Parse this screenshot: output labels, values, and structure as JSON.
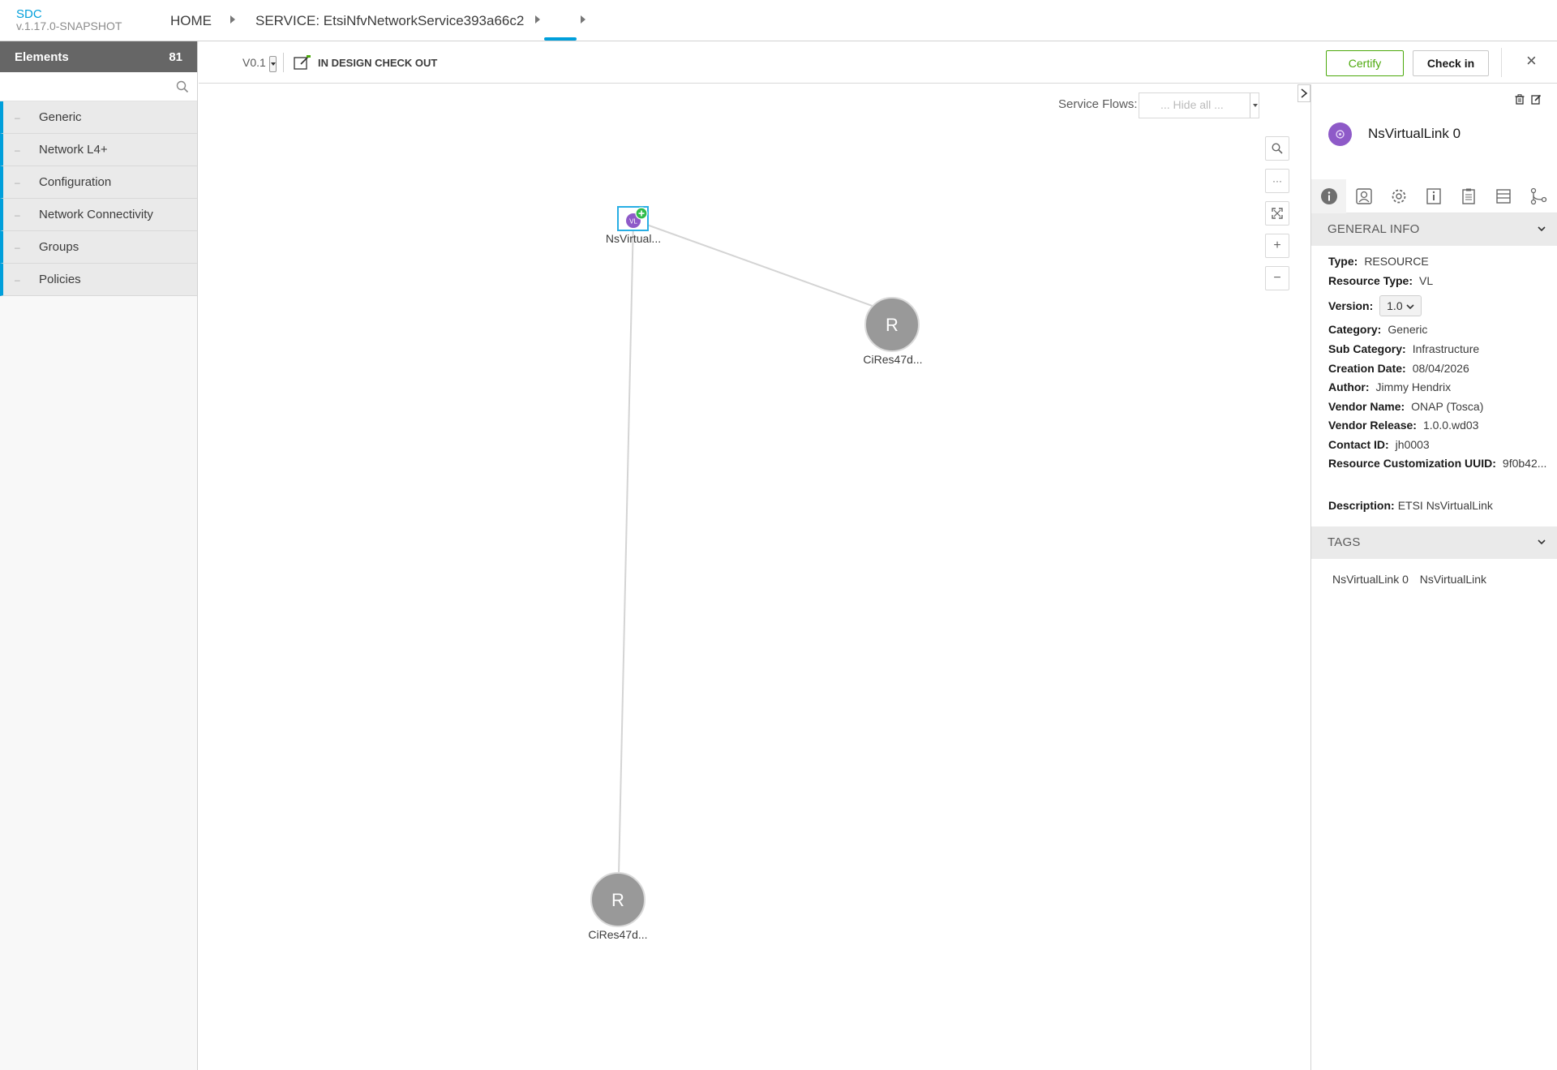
{
  "brand": {
    "name": "SDC",
    "version": "v.1.17.0-SNAPSHOT"
  },
  "breadcrumb": {
    "home": "HOME",
    "service": "SERVICE: EtsiNfvNetworkService393a66c2"
  },
  "palette": {
    "title": "Elements",
    "count": "81",
    "search_placeholder": "",
    "groups": [
      "Generic",
      "Network L4+",
      "Configuration",
      "Network Connectivity",
      "Groups",
      "Policies"
    ]
  },
  "toolbar": {
    "version": "V0.1",
    "state": "IN DESIGN CHECK OUT",
    "certify_label": "Certify",
    "checkin_label": "Check in"
  },
  "canvas": {
    "service_flows_label": "Service Flows:",
    "service_flows_value": "... Hide all ...",
    "nodes": [
      {
        "label": "NsVirtual...",
        "badge": "VL",
        "type": "vl"
      },
      {
        "label": "CiRes47d...",
        "glyph": "R",
        "type": "resource"
      },
      {
        "label": "CiRes47d...",
        "glyph": "R",
        "type": "resource"
      }
    ]
  },
  "details": {
    "title": "NsVirtualLink 0",
    "general_info_title": "GENERAL INFO",
    "type_label": "Type:",
    "type": "RESOURCE",
    "resource_type_label": "Resource Type:",
    "resource_type": "VL",
    "version_label": "Version:",
    "version": "1.0",
    "category_label": "Category:",
    "category": "Generic",
    "sub_category_label": "Sub Category:",
    "sub_category": "Infrastructure",
    "creation_date_label": "Creation Date:",
    "creation_date": "08/04/2026",
    "author_label": "Author:",
    "author": "Jimmy Hendrix",
    "vendor_name_label": "Vendor Name:",
    "vendor_name": "ONAP (Tosca)",
    "vendor_release_label": "Vendor Release:",
    "vendor_release": "1.0.0.wd03",
    "contact_id_label": "Contact ID:",
    "contact_id": "jh0003",
    "uuid_label": "Resource Customization UUID:",
    "uuid": "9f0b42...",
    "description_label": "Description:",
    "description": "ETSI NsVirtualLink",
    "tags_title": "TAGS",
    "tags": [
      "NsVirtualLink 0",
      "NsVirtualLink"
    ]
  },
  "colors": {
    "accent": "#009fdb",
    "certify": "#4ca90c",
    "vl_node": "#8e5ac8",
    "resource_node": "#999999"
  }
}
